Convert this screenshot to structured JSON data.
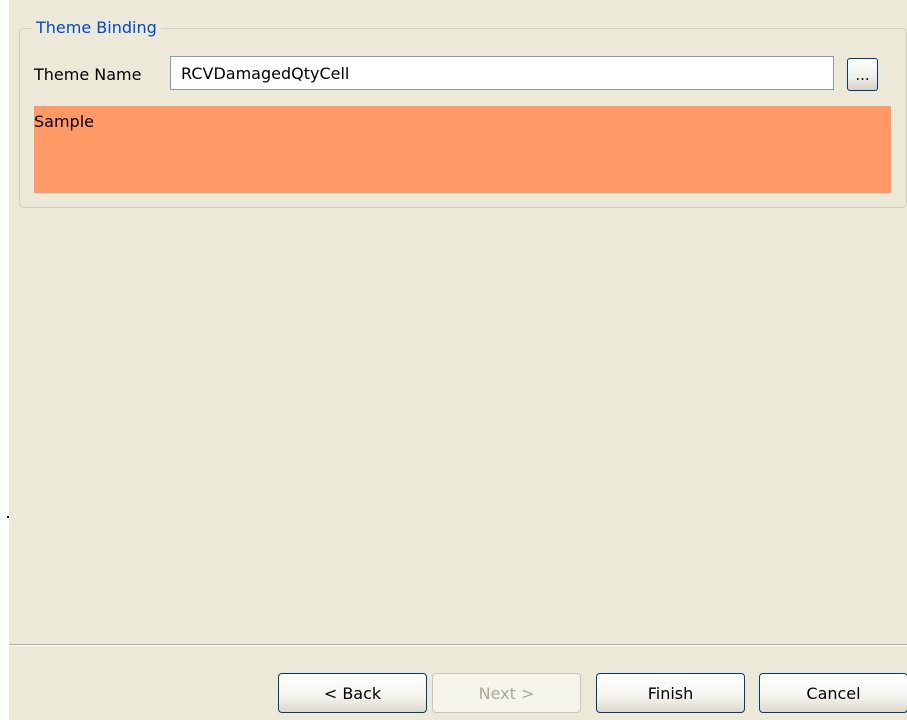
{
  "group": {
    "title": "Theme Binding"
  },
  "theme_name": {
    "label": "Theme Name",
    "value": "RCVDamagedQtyCell",
    "browse_label": "..."
  },
  "sample": {
    "text": "Sample",
    "color": "#FF9966"
  },
  "buttons": {
    "back": "< Back",
    "next": "Next >",
    "finish": "Finish",
    "cancel": "Cancel"
  },
  "colors": {
    "dialog_background": "#ECE9D8",
    "group_title": "#0046D5"
  }
}
